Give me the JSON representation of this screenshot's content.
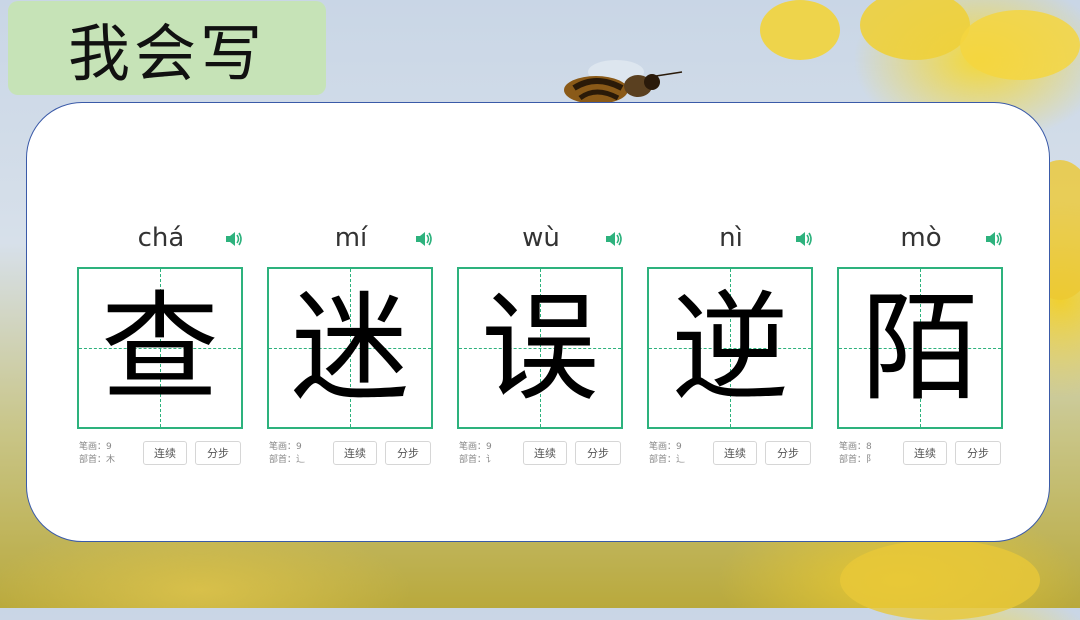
{
  "title": "我会写",
  "characters": [
    {
      "pinyin": "chá",
      "hanzi": "查",
      "strokes_label": "笔画：9",
      "radical_label": "部首：木"
    },
    {
      "pinyin": "mí",
      "hanzi": "迷",
      "strokes_label": "笔画：9",
      "radical_label": "部首：辶"
    },
    {
      "pinyin": "wù",
      "hanzi": "误",
      "strokes_label": "笔画：9",
      "radical_label": "部首：讠"
    },
    {
      "pinyin": "nì",
      "hanzi": "逆",
      "strokes_label": "笔画：9",
      "radical_label": "部首：辶"
    },
    {
      "pinyin": "mò",
      "hanzi": "陌",
      "strokes_label": "笔画：8",
      "radical_label": "部首：阝"
    }
  ],
  "buttons": {
    "continuous": "连续",
    "step": "分步"
  },
  "colors": {
    "grid": "#2db27d",
    "title_bg": "#c6e3b7",
    "card_border": "#3a5aa8"
  }
}
